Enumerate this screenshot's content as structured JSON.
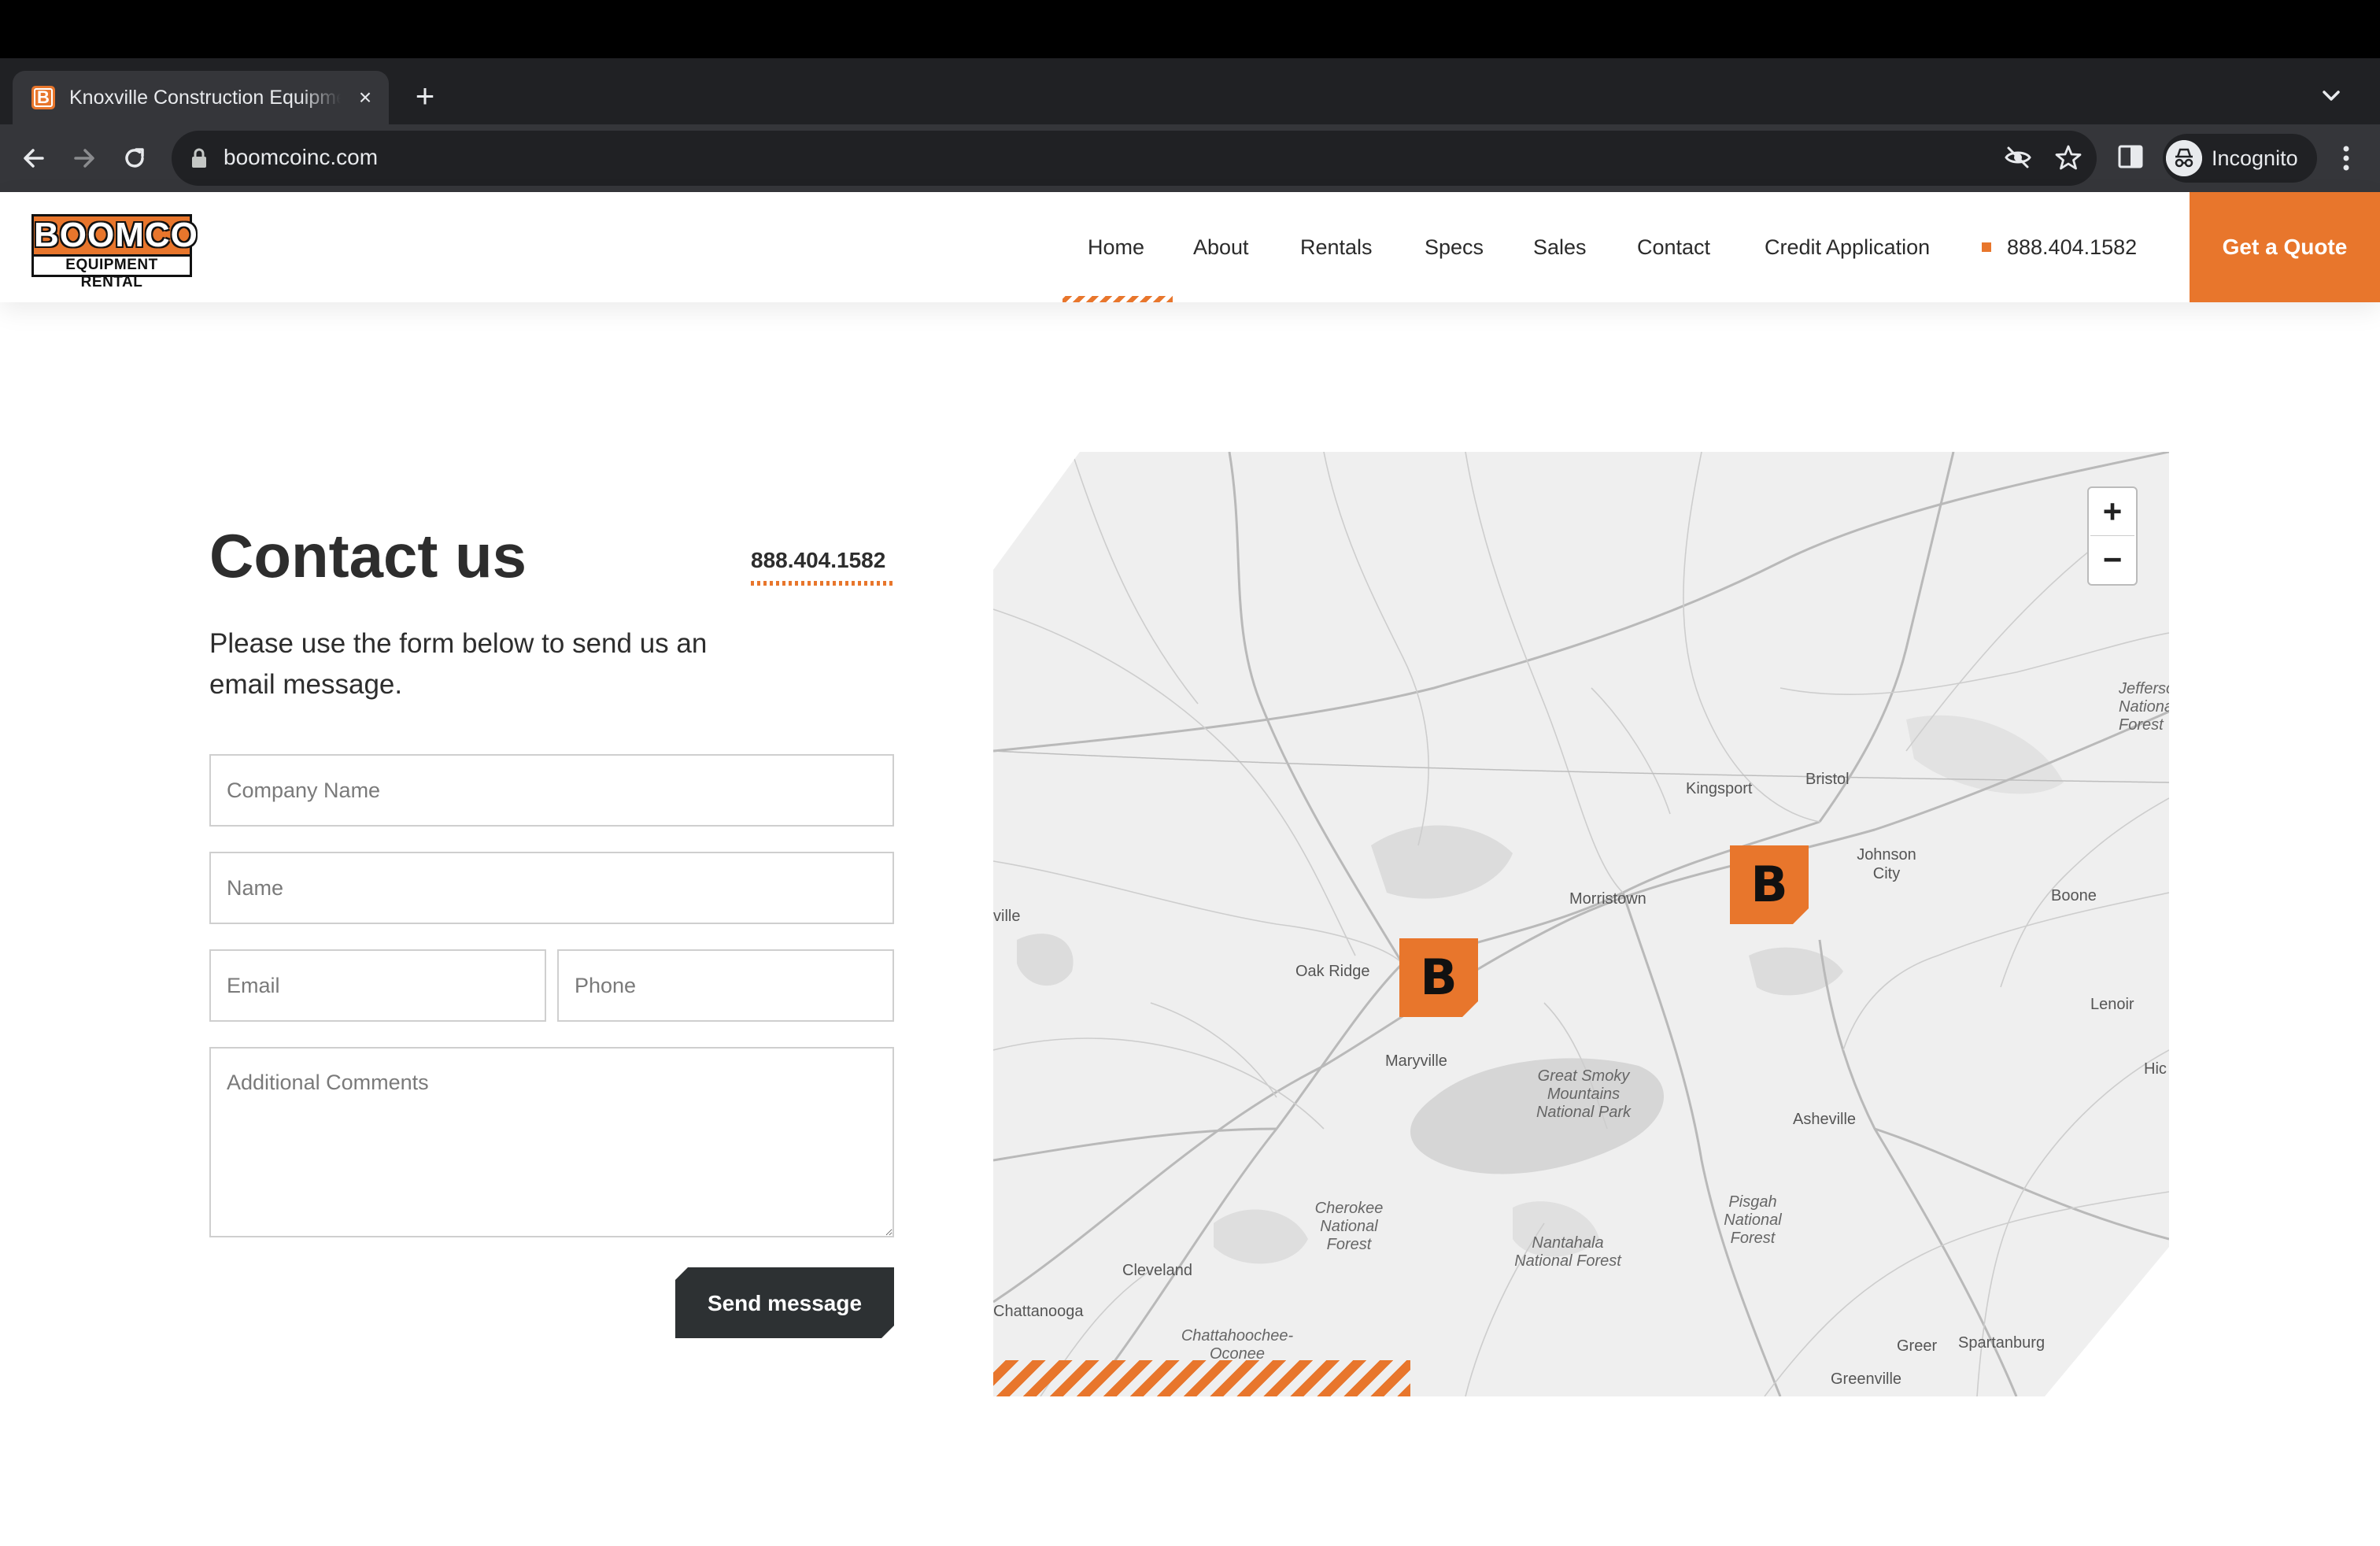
{
  "browser": {
    "tab_title": "Knoxville Construction Equipment Rental",
    "tab_favicon_letter": "B",
    "url": "boomcoinc.com",
    "profile_label": "Incognito"
  },
  "site": {
    "logo": {
      "top": "BOOMCO",
      "bottom": "EQUIPMENT RENTAL"
    },
    "nav": {
      "home": "Home",
      "about": "About",
      "rentals": "Rentals",
      "specs": "Specs",
      "sales": "Sales",
      "contact": "Contact",
      "credit": "Credit Application",
      "phone": "888.404.1582"
    },
    "quote_button": "Get a Quote",
    "accent_color": "#e8762c",
    "dark_color": "#2d3133"
  },
  "contact": {
    "title": "Contact us",
    "phone": "888.404.1582",
    "intro": "Please use the form below to send us an email message.",
    "form": {
      "company_placeholder": "Company Name",
      "name_placeholder": "Name",
      "email_placeholder": "Email",
      "phone_placeholder": "Phone",
      "comments_placeholder": "Additional Comments",
      "submit_label": "Send message"
    }
  },
  "map": {
    "zoom_in": "+",
    "zoom_out": "−",
    "marker_letter": "B",
    "labels": {
      "kingsport": "Kingsport",
      "bristol": "Bristol",
      "johnson_city": "Johnson City",
      "morristown": "Morristown",
      "oak_ridge": "Oak Ridge",
      "maryville": "Maryville",
      "boone": "Boone",
      "lenoir": "Lenoir",
      "asheville": "Asheville",
      "smoky": "Great Smoky Mountains National Park",
      "cherokee": "Cherokee National Forest",
      "nantahala": "Nantahala National Forest",
      "pisgah": "Pisgah National Forest",
      "cleveland": "Cleveland",
      "chattanooga": "Chattanooga",
      "chattahoochee": "Chattahoochee-Oconee",
      "greer": "Greer",
      "spartanburg": "Spartanburg",
      "greenville": "Greenville",
      "jefferson": "Jefferson National Forest",
      "hickory": "Hic",
      "ville": "ville"
    }
  }
}
